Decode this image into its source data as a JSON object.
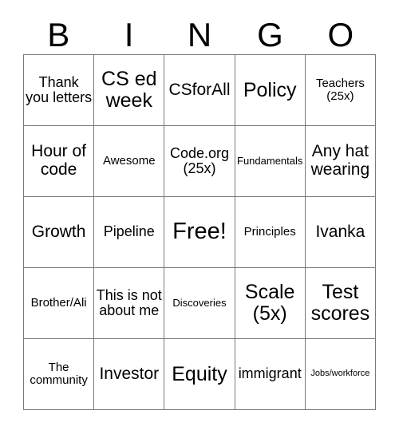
{
  "header": {
    "letters": [
      "B",
      "I",
      "N",
      "G",
      "O"
    ]
  },
  "grid": {
    "rows": 5,
    "columns": 5,
    "border_color": "#7a7a7a",
    "background_color": "#ffffff",
    "text_color": "#000000",
    "cells": [
      {
        "text": "Thank you letters",
        "size": "lg"
      },
      {
        "text": "CS ed week",
        "size": "xxl"
      },
      {
        "text": "CSforAll",
        "size": "xl"
      },
      {
        "text": "Policy",
        "size": "xxl"
      },
      {
        "text": "Teachers (25x)",
        "size": "md"
      },
      {
        "text": "Hour of code",
        "size": "xl"
      },
      {
        "text": "Awesome",
        "size": "md"
      },
      {
        "text": "Code.org (25x)",
        "size": "lg"
      },
      {
        "text": "Fundamentals",
        "size": "sm"
      },
      {
        "text": "Any hat wearing",
        "size": "xl"
      },
      {
        "text": "Growth",
        "size": "xl"
      },
      {
        "text": "Pipeline",
        "size": "lg"
      },
      {
        "text": "Free!",
        "size": "huge"
      },
      {
        "text": "Principles",
        "size": "md"
      },
      {
        "text": "Ivanka",
        "size": "xl"
      },
      {
        "text": "Brother/Ali",
        "size": "md"
      },
      {
        "text": "This is not about me",
        "size": "lg"
      },
      {
        "text": "Discoveries",
        "size": "sm"
      },
      {
        "text": "Scale (5x)",
        "size": "xxl"
      },
      {
        "text": "Test scores",
        "size": "xxl"
      },
      {
        "text": "The community",
        "size": "md"
      },
      {
        "text": "Investor",
        "size": "xl"
      },
      {
        "text": "Equity",
        "size": "xxl"
      },
      {
        "text": "immigrant",
        "size": "lg"
      },
      {
        "text": "Jobs/workforce",
        "size": "xs"
      }
    ]
  }
}
